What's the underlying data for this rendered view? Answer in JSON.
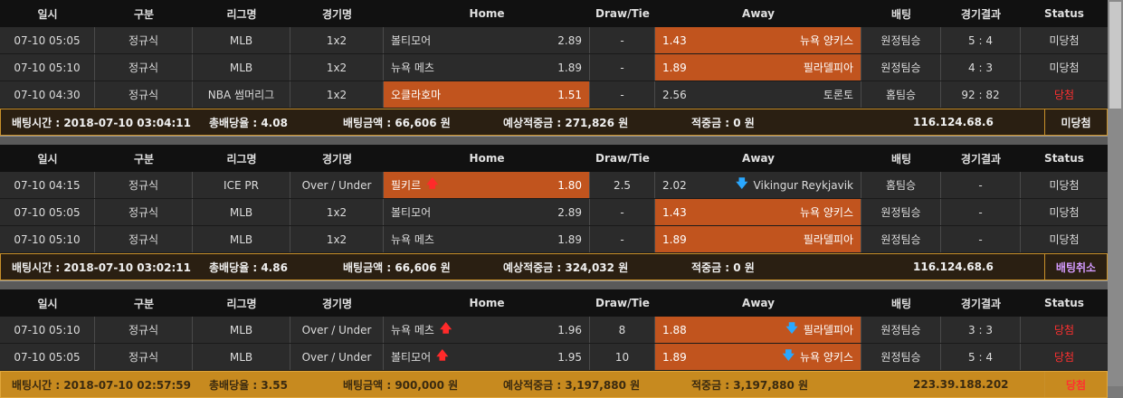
{
  "headers": {
    "date": "일시",
    "type": "구분",
    "league": "리그명",
    "game": "경기명",
    "home": "Home",
    "draw": "Draw/Tie",
    "away": "Away",
    "bet": "배팅",
    "result": "경기결과",
    "status": "Status"
  },
  "slips": [
    {
      "rows": [
        {
          "date": "07-10 05:05",
          "type": "정규식",
          "league": "MLB",
          "game": "1x2",
          "home": "볼티모어",
          "home_odds": "2.89",
          "draw": "-",
          "away_odds": "1.43",
          "away": "뉴욕 양키스",
          "bet": "원정팀승",
          "result": "5 : 4",
          "status": "미당첨",
          "selected": "away",
          "home_arrow": "",
          "away_arrow": "",
          "status_win": false
        },
        {
          "date": "07-10 05:10",
          "type": "정규식",
          "league": "MLB",
          "game": "1x2",
          "home": "뉴욕 메츠",
          "home_odds": "1.89",
          "draw": "-",
          "away_odds": "1.89",
          "away": "필라델피아",
          "bet": "원정팀승",
          "result": "4 : 3",
          "status": "미당첨",
          "selected": "away",
          "home_arrow": "",
          "away_arrow": "",
          "status_win": false
        },
        {
          "date": "07-10 04:30",
          "type": "정규식",
          "league": "NBA 썸머리그",
          "game": "1x2",
          "home": "오클라호마",
          "home_odds": "1.51",
          "draw": "-",
          "away_odds": "2.56",
          "away": "토론토",
          "bet": "홈팀승",
          "result": "92 : 82",
          "status": "당첨",
          "selected": "home",
          "home_arrow": "",
          "away_arrow": "",
          "status_win": true
        }
      ],
      "summary": {
        "time": "배팅시간 : 2018-07-10 03:04:11",
        "total_odds": "총배당율 : 4.08",
        "amount": "배팅금액 : 66,606 원",
        "expected": "예상적중금 : 271,826 원",
        "hit": "적중금 : 0 원",
        "ip": "116.124.68.6",
        "status": "미당첨",
        "status_kind": "normal",
        "gold": false
      }
    },
    {
      "rows": [
        {
          "date": "07-10 04:15",
          "type": "정규식",
          "league": "ICE PR",
          "game": "Over / Under",
          "home": "필키르",
          "home_odds": "1.80",
          "draw": "2.5",
          "away_odds": "2.02",
          "away": "Vikingur Reykjavik",
          "bet": "홈팀승",
          "result": "-",
          "status": "미당첨",
          "selected": "home",
          "home_arrow": "up",
          "away_arrow": "down",
          "status_win": false
        },
        {
          "date": "07-10 05:05",
          "type": "정규식",
          "league": "MLB",
          "game": "1x2",
          "home": "볼티모어",
          "home_odds": "2.89",
          "draw": "-",
          "away_odds": "1.43",
          "away": "뉴욕 양키스",
          "bet": "원정팀승",
          "result": "-",
          "status": "미당첨",
          "selected": "away",
          "home_arrow": "",
          "away_arrow": "",
          "status_win": false
        },
        {
          "date": "07-10 05:10",
          "type": "정규식",
          "league": "MLB",
          "game": "1x2",
          "home": "뉴욕 메츠",
          "home_odds": "1.89",
          "draw": "-",
          "away_odds": "1.89",
          "away": "필라델피아",
          "bet": "원정팀승",
          "result": "-",
          "status": "미당첨",
          "selected": "away",
          "home_arrow": "",
          "away_arrow": "",
          "status_win": false
        }
      ],
      "summary": {
        "time": "배팅시간 : 2018-07-10 03:02:11",
        "total_odds": "총배당율 : 4.86",
        "amount": "배팅금액 : 66,606 원",
        "expected": "예상적중금 : 324,032 원",
        "hit": "적중금 : 0 원",
        "ip": "116.124.68.6",
        "status": "배팅취소",
        "status_kind": "cancel",
        "gold": false
      }
    },
    {
      "rows": [
        {
          "date": "07-10 05:10",
          "type": "정규식",
          "league": "MLB",
          "game": "Over / Under",
          "home": "뉴욕 메츠",
          "home_odds": "1.96",
          "draw": "8",
          "away_odds": "1.88",
          "away": "필라델피아",
          "bet": "원정팀승",
          "result": "3 : 3",
          "status": "당첨",
          "selected": "away",
          "home_arrow": "up",
          "away_arrow": "down",
          "status_win": true
        },
        {
          "date": "07-10 05:05",
          "type": "정규식",
          "league": "MLB",
          "game": "Over / Under",
          "home": "볼티모어",
          "home_odds": "1.95",
          "draw": "10",
          "away_odds": "1.89",
          "away": "뉴욕 양키스",
          "bet": "원정팀승",
          "result": "5 : 4",
          "status": "당첨",
          "selected": "away",
          "home_arrow": "up",
          "away_arrow": "down",
          "status_win": true
        }
      ],
      "summary": {
        "time": "배팅시간 : 2018-07-10 02:57:59",
        "total_odds": "총배당율 : 3.55",
        "amount": "배팅금액 : 900,000 원",
        "expected": "예상적중금 : 3,197,880 원",
        "hit": "적중금 : 3,197,880 원",
        "ip": "223.39.188.202",
        "status": "당첨",
        "status_kind": "win",
        "gold": true
      }
    }
  ]
}
